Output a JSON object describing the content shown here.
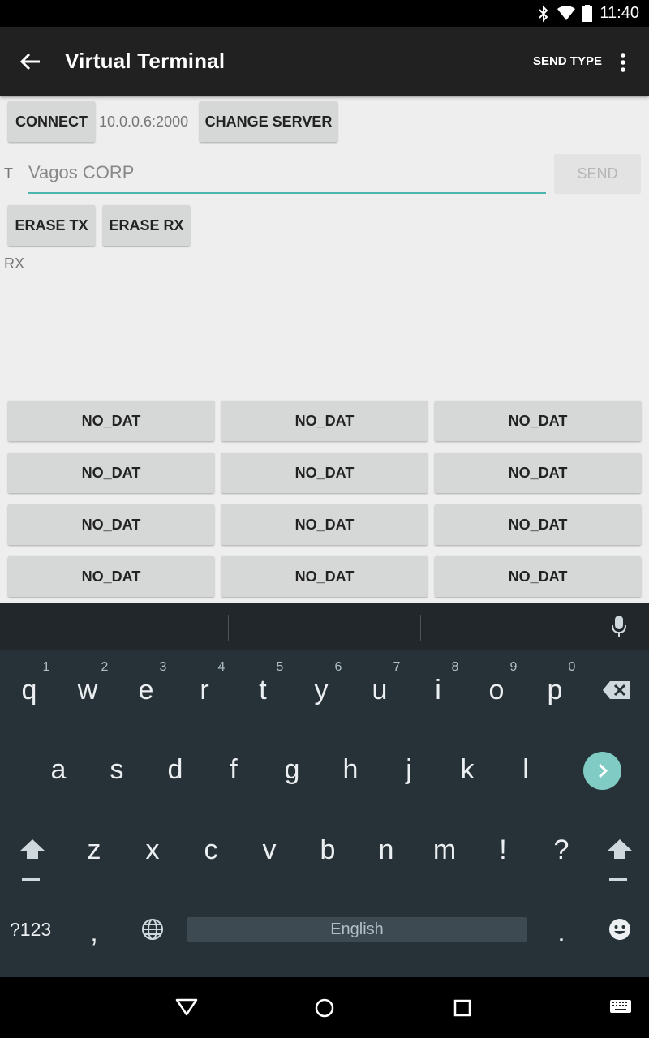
{
  "status_bar": {
    "time": "11:40",
    "icons": [
      "bluetooth-icon",
      "wifi-icon",
      "battery-icon"
    ]
  },
  "app_bar": {
    "title": "Virtual Terminal",
    "send_type": "SEND TYPE"
  },
  "connection": {
    "connect_label": "CONNECT",
    "server_address": "10.0.0.6:2000",
    "change_server_label": "CHANGE SERVER"
  },
  "tx": {
    "label": "T",
    "input_value": "Vagos CORP",
    "send_label": "SEND"
  },
  "erase": {
    "tx_label": "ERASE TX",
    "rx_label": "ERASE RX"
  },
  "rx": {
    "label": "RX"
  },
  "grid_buttons": [
    "NO_DAT",
    "NO_DAT",
    "NO_DAT",
    "NO_DAT",
    "NO_DAT",
    "NO_DAT",
    "NO_DAT",
    "NO_DAT",
    "NO_DAT",
    "NO_DAT",
    "NO_DAT",
    "NO_DAT"
  ],
  "keyboard": {
    "row1": [
      "q",
      "w",
      "e",
      "r",
      "t",
      "y",
      "u",
      "i",
      "o",
      "p"
    ],
    "row1_hints": [
      "1",
      "2",
      "3",
      "4",
      "5",
      "6",
      "7",
      "8",
      "9",
      "0"
    ],
    "row2": [
      "a",
      "s",
      "d",
      "f",
      "g",
      "h",
      "j",
      "k",
      "l"
    ],
    "row3": [
      "z",
      "x",
      "c",
      "v",
      "b",
      "n",
      "m",
      "!",
      "?"
    ],
    "symbols_label": "?123",
    "comma": ",",
    "period": ".",
    "space_label": "English"
  },
  "colors": {
    "accent": "#4db6ac",
    "keyboard_bg": "#263238",
    "appbar_bg": "#212121"
  }
}
